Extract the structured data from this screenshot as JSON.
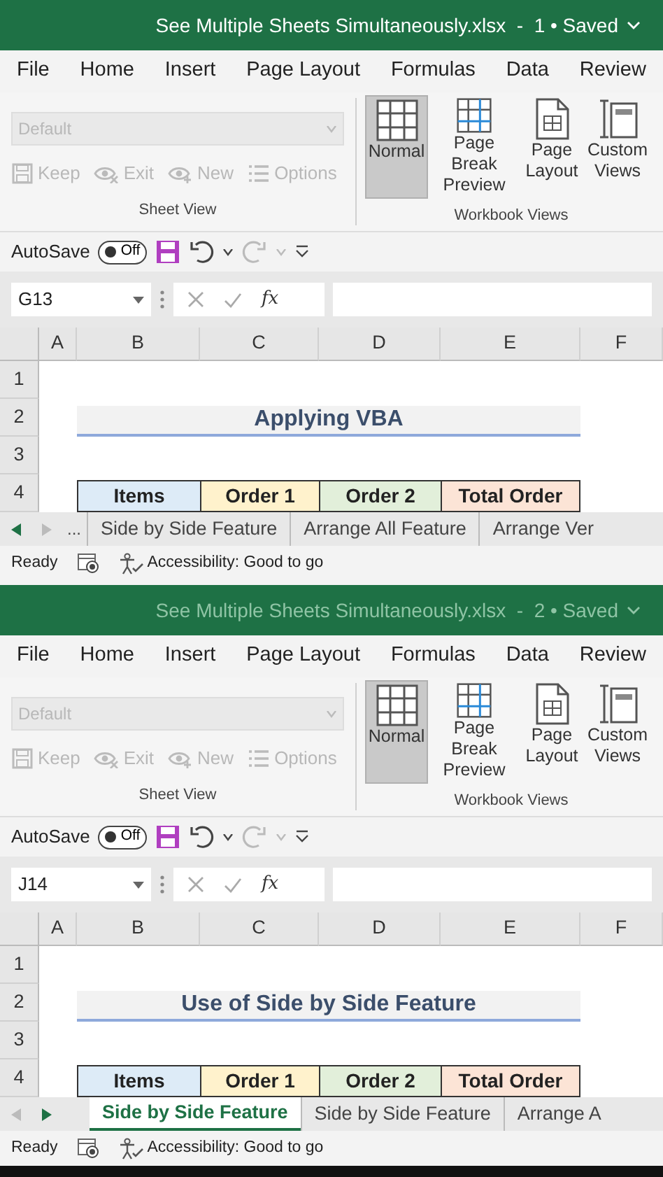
{
  "windows": [
    {
      "title": "See Multiple Sheets Simultaneously.xlsx  -  1 • Saved",
      "active": true,
      "menu": [
        {
          "label": "File",
          "selected": false
        },
        {
          "label": "Home",
          "selected": false
        },
        {
          "label": "Insert",
          "selected": false
        },
        {
          "label": "Page Layout",
          "selected": false
        },
        {
          "label": "Formulas",
          "selected": false
        },
        {
          "label": "Data",
          "selected": false
        },
        {
          "label": "Review",
          "selected": false
        }
      ],
      "sheet_view": {
        "dropdown": {
          "value": "Default",
          "disabled": true
        },
        "buttons": [
          {
            "kind": "keep",
            "label": "Keep",
            "disabled": true
          },
          {
            "kind": "exit",
            "label": "Exit",
            "disabled": true
          },
          {
            "kind": "new",
            "label": "New",
            "disabled": true
          },
          {
            "kind": "options",
            "label": "Options",
            "disabled": true
          }
        ],
        "label": "Sheet View"
      },
      "workbook_views": {
        "buttons": [
          {
            "kind": "normal",
            "lines": [
              "Normal"
            ],
            "selected": true
          },
          {
            "kind": "page-break",
            "lines": [
              "Page Break",
              "Preview"
            ],
            "selected": false
          },
          {
            "kind": "page-layout",
            "lines": [
              "Page",
              "Layout"
            ],
            "selected": false
          },
          {
            "kind": "custom",
            "lines": [
              "Custom",
              "Views"
            ],
            "selected": false
          }
        ],
        "label": "Workbook Views"
      },
      "autosave": {
        "label": "AutoSave",
        "on": false,
        "state": "Off"
      },
      "redo_disabled": true,
      "name_box": "G13",
      "fx": "fx",
      "columns": [
        "A",
        "B",
        "C",
        "D",
        "E",
        "F"
      ],
      "rows": [
        "1",
        "2",
        "3",
        "4"
      ],
      "heading": "Applying VBA",
      "headers": [
        {
          "text": "Items",
          "color": "#ddebf7"
        },
        {
          "text": "Order 1",
          "color": "#fff2cc"
        },
        {
          "text": "Order 2",
          "color": "#e2efda"
        },
        {
          "text": "Total Order",
          "color": "#fce4d6"
        }
      ],
      "sheet_nav": {
        "back_disabled": false,
        "forward_disabled": true,
        "more": "..."
      },
      "sheet_tabs": [
        {
          "label": "Side by Side Feature",
          "selected": false
        },
        {
          "label": "Arrange All Feature",
          "selected": false
        },
        {
          "label": "Arrange Ver",
          "selected": false
        }
      ],
      "status": "Ready",
      "accessibility": "Accessibility: Good to go"
    },
    {
      "title": "See Multiple Sheets Simultaneously.xlsx  -  2 • Saved",
      "active": false,
      "menu": [
        {
          "label": "File",
          "selected": false
        },
        {
          "label": "Home",
          "selected": false
        },
        {
          "label": "Insert",
          "selected": false
        },
        {
          "label": "Page Layout",
          "selected": false
        },
        {
          "label": "Formulas",
          "selected": false
        },
        {
          "label": "Data",
          "selected": false
        },
        {
          "label": "Review",
          "selected": false
        }
      ],
      "sheet_view": {
        "dropdown": {
          "value": "Default",
          "disabled": true
        },
        "buttons": [
          {
            "kind": "keep",
            "label": "Keep",
            "disabled": true
          },
          {
            "kind": "exit",
            "label": "Exit",
            "disabled": true
          },
          {
            "kind": "new",
            "label": "New",
            "disabled": true
          },
          {
            "kind": "options",
            "label": "Options",
            "disabled": true
          }
        ],
        "label": "Sheet View"
      },
      "workbook_views": {
        "buttons": [
          {
            "kind": "normal",
            "lines": [
              "Normal"
            ],
            "selected": true
          },
          {
            "kind": "page-break",
            "lines": [
              "Page Break",
              "Preview"
            ],
            "selected": false
          },
          {
            "kind": "page-layout",
            "lines": [
              "Page",
              "Layout"
            ],
            "selected": false
          },
          {
            "kind": "custom",
            "lines": [
              "Custom",
              "Views"
            ],
            "selected": false
          }
        ],
        "label": "Workbook Views"
      },
      "autosave": {
        "label": "AutoSave",
        "on": false,
        "state": "Off"
      },
      "redo_disabled": true,
      "name_box": "J14",
      "fx": "fx",
      "columns": [
        "A",
        "B",
        "C",
        "D",
        "E",
        "F"
      ],
      "rows": [
        "1",
        "2",
        "3",
        "4"
      ],
      "heading": "Use of Side by Side Feature",
      "headers": [
        {
          "text": "Items",
          "color": "#ddebf7"
        },
        {
          "text": "Order 1",
          "color": "#fff2cc"
        },
        {
          "text": "Order 2",
          "color": "#e2efda"
        },
        {
          "text": "Total Order",
          "color": "#fce4d6"
        }
      ],
      "sheet_nav": {
        "back_disabled": true,
        "forward_disabled": false
      },
      "sheet_tabs": [
        {
          "label": "Side by Side Feature",
          "selected": true
        },
        {
          "label": "Side by Side Feature",
          "selected": false
        },
        {
          "label": "Arrange A",
          "selected": false
        }
      ],
      "status": "Ready",
      "accessibility": "Accessibility: Good to go"
    }
  ]
}
